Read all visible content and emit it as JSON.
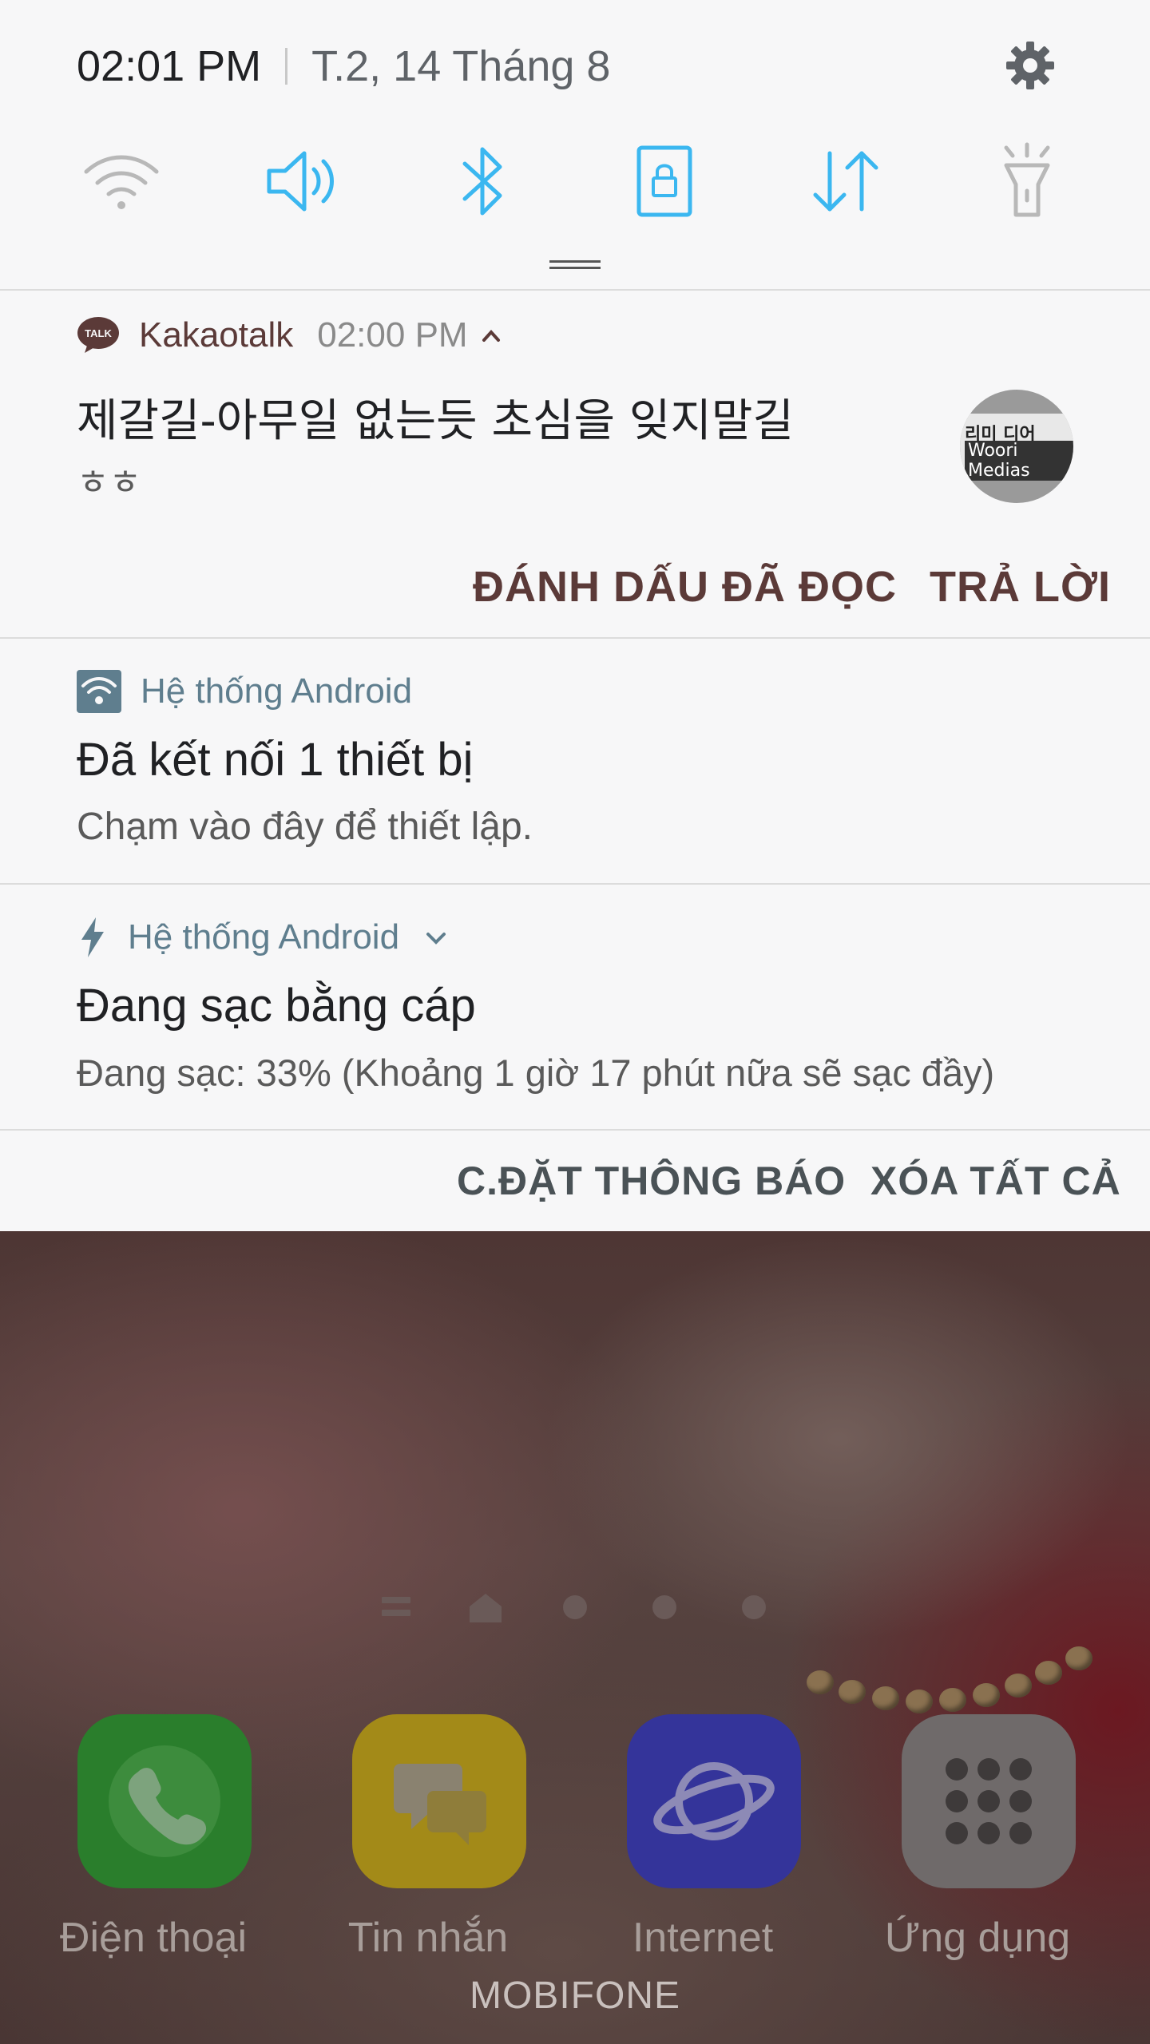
{
  "status_bar": {
    "time": "02:01 PM",
    "date": "T.2, 14 Tháng 8",
    "settings_icon": "gear-icon"
  },
  "quick_settings": [
    {
      "name": "wifi",
      "icon": "wifi-icon",
      "active": false
    },
    {
      "name": "sound",
      "icon": "speaker-icon",
      "active": true
    },
    {
      "name": "bluetooth",
      "icon": "bluetooth-icon",
      "active": true
    },
    {
      "name": "screen-rotation-lock",
      "icon": "rotation-lock-icon",
      "active": true
    },
    {
      "name": "mobile-data",
      "icon": "data-transfer-icon",
      "active": true
    },
    {
      "name": "flashlight",
      "icon": "flashlight-icon",
      "active": false
    }
  ],
  "colors": {
    "accent": "#3bb7f0",
    "inactive": "#b5b5b5",
    "kakao_text": "#5b3a38",
    "android_text": "#5f7e8e"
  },
  "notifications": {
    "kakao": {
      "app": "Kakaotalk",
      "time": "02:00 PM",
      "title": "제갈길-아무일 없는듯 초심을 잊지말길",
      "text": "ㅎㅎ",
      "avatar_line1": "리미 디어",
      "avatar_line2": "Woori Medias",
      "actions": {
        "mark_read": "ĐÁNH DẤU ĐÃ ĐỌC",
        "reply": "TRẢ LỜI"
      }
    },
    "hotspot": {
      "app": "Hệ thống Android",
      "title": "Đã kết nối 1 thiết bị",
      "text": "Chạm vào đây để thiết lập."
    },
    "charging": {
      "app": "Hệ thống Android",
      "title": "Đang sạc bằng cáp",
      "text": "Đang sạc: 33% (Khoảng 1 giờ 17 phút nữa sẽ sạc đầy)"
    }
  },
  "footer_actions": {
    "notification_settings": "C.ĐẶT THÔNG BÁO",
    "clear_all": "XÓA TẤT CẢ"
  },
  "home": {
    "dock": [
      {
        "label": "Điện thoại",
        "icon": "phone-icon",
        "color": "#1f8a2a"
      },
      {
        "label": "Tin nhắn",
        "icon": "messages-icon",
        "color": "#b39a18"
      },
      {
        "label": "Internet",
        "icon": "internet-planet-icon",
        "color": "#3838a0"
      },
      {
        "label": "Ứng dụng",
        "icon": "apps-grid-icon",
        "color": "#7a7474"
      }
    ],
    "carrier": "MOBIFONE"
  }
}
